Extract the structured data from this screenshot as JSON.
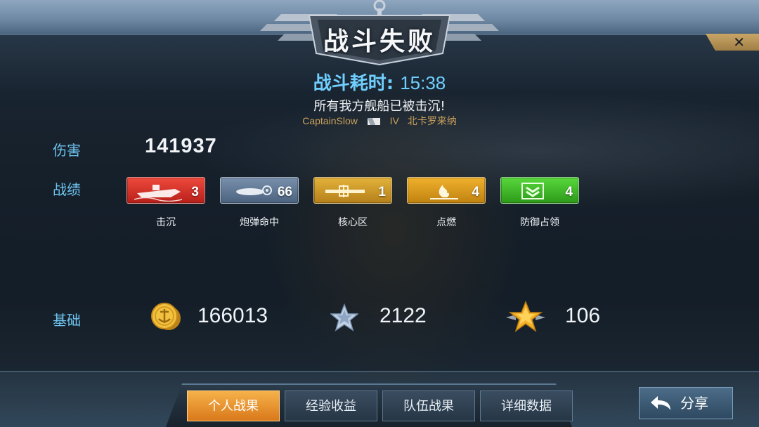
{
  "header": {
    "title": "战斗失败",
    "close_label": "✕"
  },
  "battle": {
    "duration_label": "战斗耗时:",
    "duration_value": "15:38",
    "result_message": "所有我方舰船已被击沉!",
    "player_name": "CaptainSlow",
    "ship_tier": "IV",
    "ship_name": "北卡罗来纳"
  },
  "stats": {
    "damage_label": "伤害",
    "damage_value": "141937",
    "achievements_label": "战绩",
    "achievements": [
      {
        "label": "击沉",
        "count": "3",
        "color": "#d9322b",
        "icon": "sink-ship-icon"
      },
      {
        "label": "炮弹命中",
        "count": "66",
        "color": "#5b7391",
        "icon": "shell-hit-icon"
      },
      {
        "label": "核心区",
        "count": "1",
        "color": "#c9951f",
        "icon": "citadel-icon"
      },
      {
        "label": "点燃",
        "count": "4",
        "color": "#d99a1c",
        "icon": "fire-icon"
      },
      {
        "label": "防御占领",
        "count": "4",
        "color": "#3fb82a",
        "icon": "defend-capture-icon"
      }
    ],
    "base_label": "基础",
    "base": {
      "credits": "166013",
      "xp": "2122",
      "captain_xp": "106"
    }
  },
  "tabs": [
    {
      "label": "个人战果",
      "active": true
    },
    {
      "label": "经验收益",
      "active": false
    },
    {
      "label": "队伍战果",
      "active": false
    },
    {
      "label": "详细数据",
      "active": false
    }
  ],
  "share_label": "分享",
  "colors": {
    "accent_blue": "#6fc4f0",
    "tab_active": "#e8922e",
    "player_line": "#c9a15c"
  }
}
